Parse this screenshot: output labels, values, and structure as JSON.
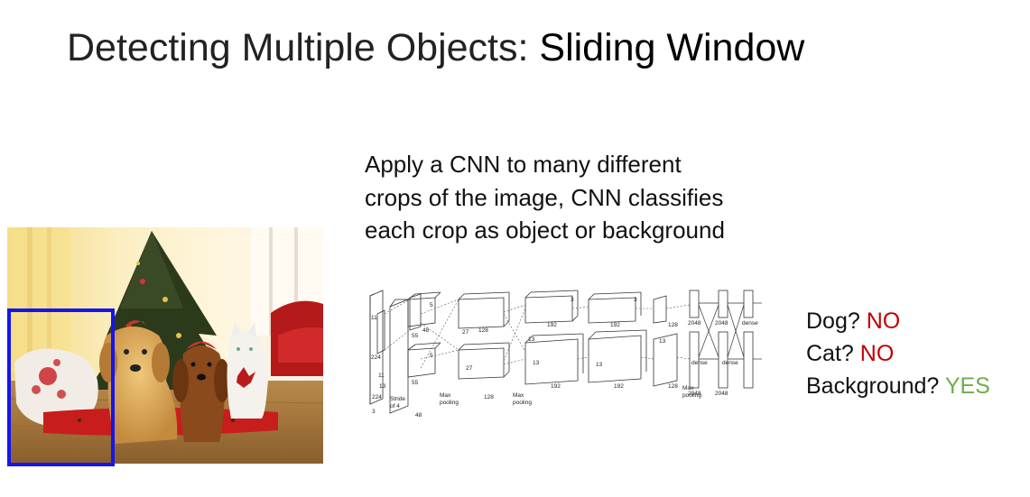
{
  "slide": {
    "title_prefix": "Detecting Multiple Objects: ",
    "title_bold": "Sliding Window",
    "description_lines": [
      "Apply a CNN to many different",
      "crops of the image, CNN classifies",
      "each crop as object or background"
    ]
  },
  "network": {
    "labels": {
      "l224a": "224",
      "l224b": "224",
      "l11a": "11",
      "l11b": "11",
      "l5a": "5",
      "l5b": "5",
      "l55a": "55",
      "l55b": "55",
      "l27a": "27",
      "l27b": "27",
      "l3a": "3",
      "l3b": "3",
      "l3c": "3",
      "l13a": "13",
      "l13b": "13",
      "l13c": "13",
      "l13d": "13",
      "l13e": "13",
      "l48a": "48",
      "l48b": "48",
      "l128a": "128",
      "l128b": "128",
      "l128c": "128",
      "l128d": "128",
      "l192a": "192",
      "l192b": "192",
      "l192c": "192",
      "l192d": "192",
      "l2048a": "2048",
      "l2048b": "2048",
      "l2048c": "2048",
      "l2048d": "2048",
      "dense_a": "dense",
      "dense_b": "dense",
      "dense_c": "dense",
      "stride1": "Stride",
      "stride2": "of 4",
      "maxpool1a": "Max",
      "maxpool1b": "pooling",
      "maxpool2a": "Max",
      "maxpool2b": "pooling",
      "maxpool3a": "Max",
      "maxpool3b": "pooling"
    }
  },
  "answers": [
    {
      "question": "Dog? ",
      "answer": "NO",
      "status_color": "#c00000"
    },
    {
      "question": "Cat? ",
      "answer": "NO",
      "status_color": "#c00000"
    },
    {
      "question": "Background? ",
      "answer": "YES",
      "status_color": "#70ad47"
    }
  ],
  "colors": {
    "crop_box": "#1515ee",
    "no": "#c00000",
    "yes": "#70ad47"
  }
}
